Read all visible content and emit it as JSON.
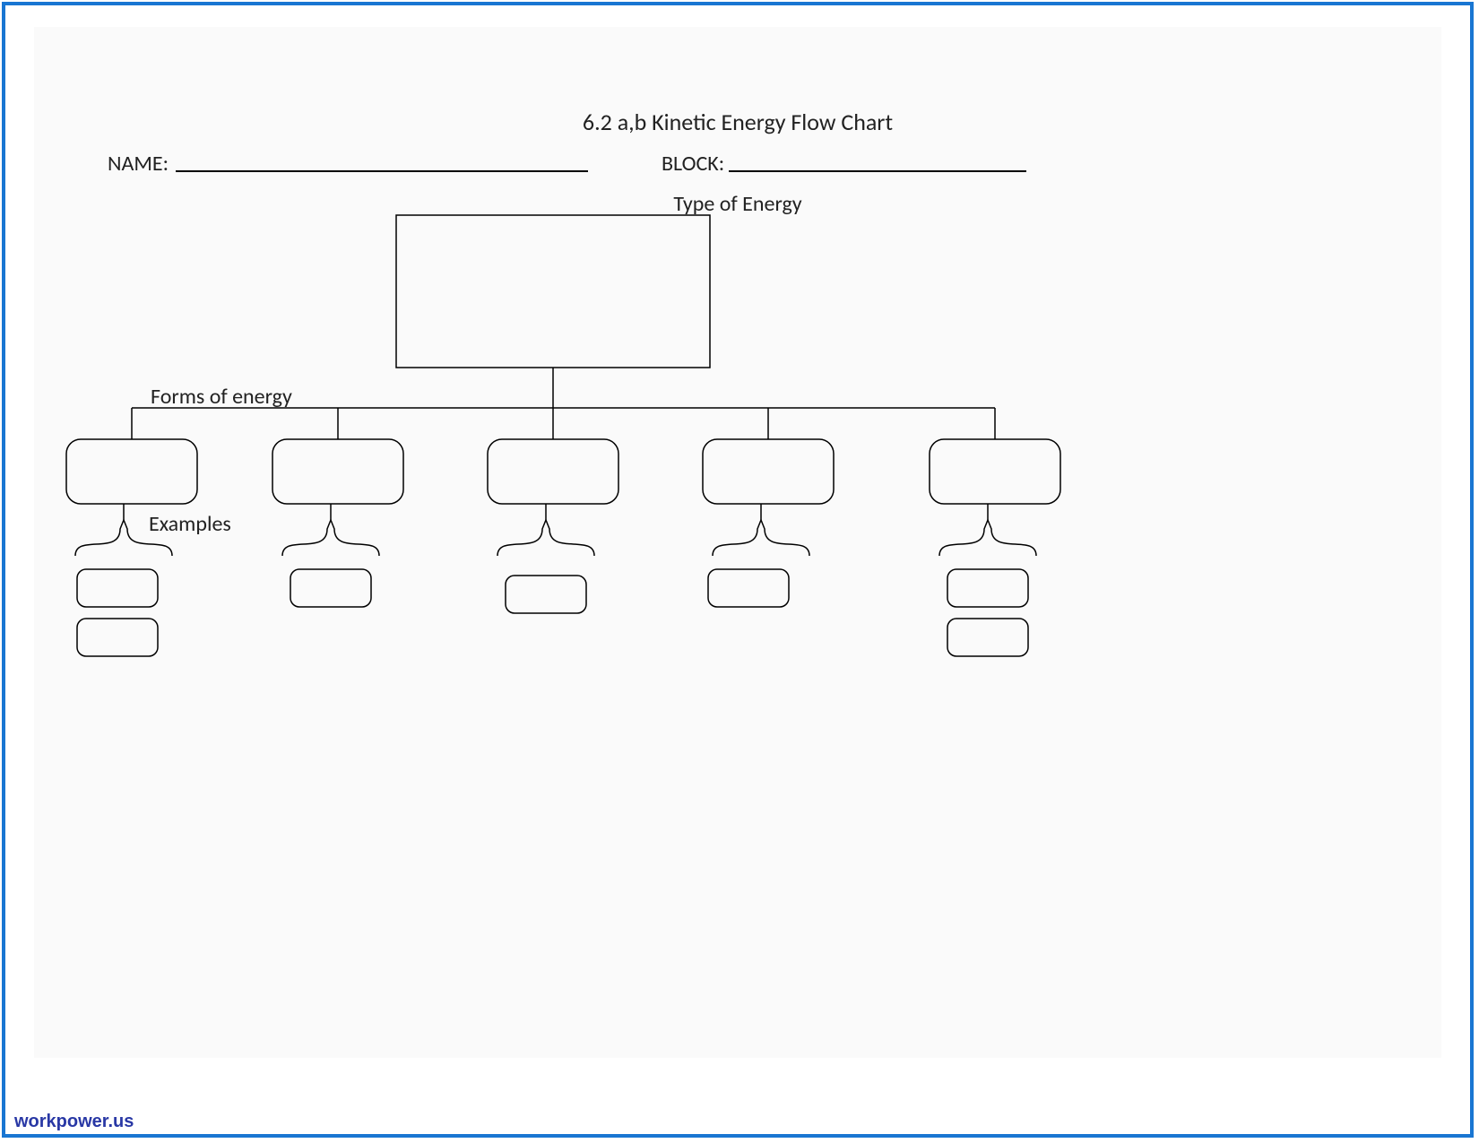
{
  "title": "6.2 a,b Kinetic Energy Flow Chart",
  "labels": {
    "name": "NAME:",
    "block": "BLOCK:",
    "type": "Type of Energy",
    "forms": "Forms of energy",
    "examples": "Examples"
  },
  "watermark": "workpower.us",
  "name_value": "",
  "block_value": "",
  "boxes": {
    "top": "",
    "forms": [
      "",
      "",
      "",
      "",
      ""
    ],
    "examples": [
      [
        "",
        ""
      ],
      [
        ""
      ],
      [
        ""
      ],
      [
        ""
      ],
      [
        "",
        ""
      ]
    ]
  }
}
